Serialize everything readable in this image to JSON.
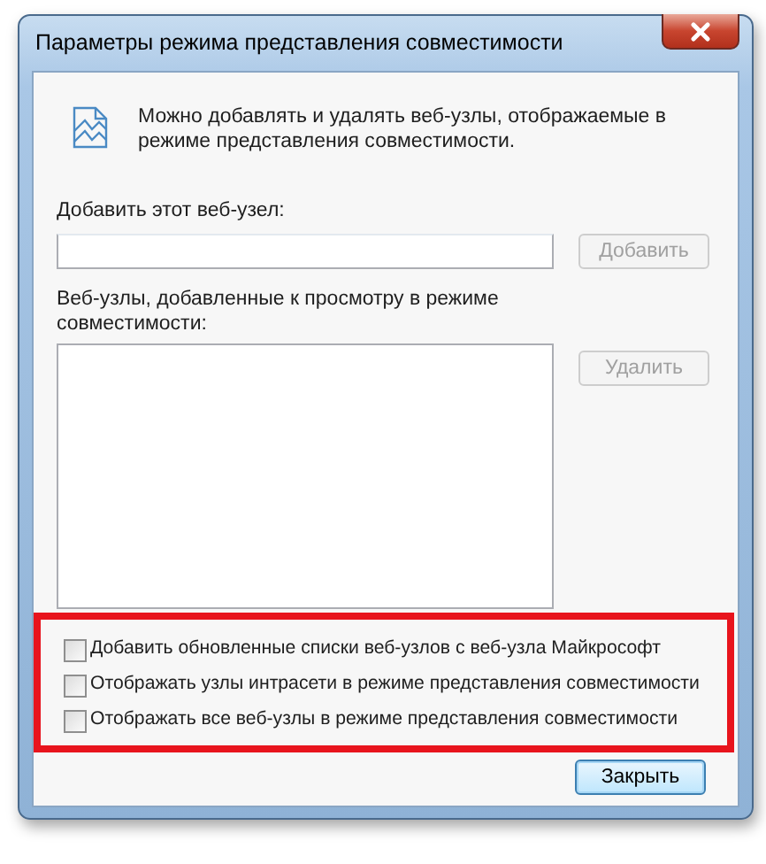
{
  "window": {
    "title": "Параметры режима представления совместимости"
  },
  "intro": "Можно добавлять и удалять веб-узлы, отображаемые в режиме представления совместимости.",
  "add_site": {
    "label": "Добавить этот веб-узел:",
    "button": {
      "label": "Добавить",
      "disabled": true
    }
  },
  "site_list": {
    "label": "Веб-узлы, добавленные к просмотру в режиме совместимости:",
    "button": {
      "label": "Удалить",
      "disabled": true
    }
  },
  "options_highlighted": true,
  "options": [
    {
      "label": "Добавить обновленные списки веб-узлов с веб-узла Майкрософт",
      "checked": false
    },
    {
      "label": "Отображать узлы интрасети в режиме представления совместимости",
      "checked": false
    },
    {
      "label": "Отображать все веб-узлы в режиме представления совместимости",
      "checked": false
    }
  ],
  "close_button": {
    "label": "Закрыть",
    "default": true
  }
}
